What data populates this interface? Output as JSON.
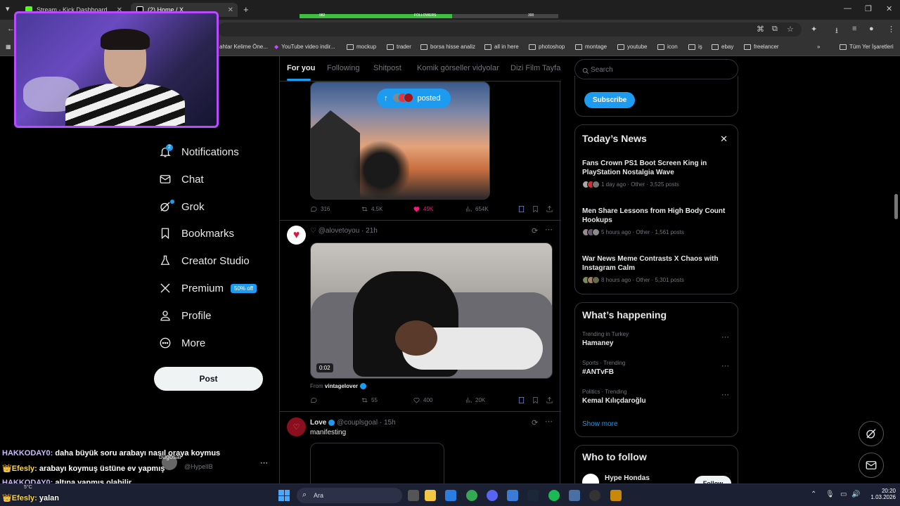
{
  "browser": {
    "tabs": [
      {
        "title": "Stream - Kick Dashboard",
        "color": "#53fc18"
      },
      {
        "title": "(2) Home / X",
        "color": "#ffffff"
      }
    ],
    "overlay_bar": {
      "left_value": "982",
      "center_label": "FOLLOWERS",
      "right_value": "300",
      "progress": 0.59
    },
    "bookmarks": [
      {
        "label": "ahtar Kelime Öne...",
        "icon": "folder-icon"
      },
      {
        "label": "YouTube video indir...",
        "icon": "bookmark-icon"
      },
      {
        "label": "mockup",
        "icon": "folder-icon"
      },
      {
        "label": "trader",
        "icon": "folder-icon"
      },
      {
        "label": "borsa hisse analiz",
        "icon": "folder-icon"
      },
      {
        "label": "all in here",
        "icon": "folder-icon"
      },
      {
        "label": "photoshop",
        "icon": "folder-icon"
      },
      {
        "label": "montage",
        "icon": "folder-icon"
      },
      {
        "label": "youtube",
        "icon": "folder-icon"
      },
      {
        "label": "icon",
        "icon": "folder-icon"
      },
      {
        "label": "iş",
        "icon": "folder-icon"
      },
      {
        "label": "ebay",
        "icon": "folder-icon"
      },
      {
        "label": "freelancer",
        "icon": "folder-icon"
      }
    ],
    "all_bookmarks": "Tüm Yer İşaretleri"
  },
  "nav": {
    "items": [
      {
        "label": "Notifications",
        "icon": "bell-icon",
        "badge": "2"
      },
      {
        "label": "Chat",
        "icon": "mail-icon"
      },
      {
        "label": "Grok",
        "icon": "grok-icon"
      },
      {
        "label": "Bookmarks",
        "icon": "bookmark-icon"
      },
      {
        "label": "Creator Studio",
        "icon": "flask-icon"
      },
      {
        "label": "Premium",
        "icon": "x-logo-icon",
        "badge": "50% off"
      },
      {
        "label": "Profile",
        "icon": "person-icon"
      },
      {
        "label": "More",
        "icon": "more-circle-icon"
      }
    ],
    "post_label": "Post"
  },
  "feed": {
    "tabs": [
      "For you",
      "Following",
      "Shitpost",
      "Komik görseller vidyolar",
      "Dizi Film Tayfa"
    ],
    "posted_pill": "posted",
    "post1": {
      "replies": "316",
      "reposts": "4.5K",
      "likes": "49K",
      "views": "654K"
    },
    "post2": {
      "handle": "♡ @alovetoyou · 21h",
      "video_time": "0:02",
      "from_prefix": "From",
      "from_user": "vintagelover",
      "replies": "",
      "reposts": "55",
      "likes": "400",
      "views": "20K"
    },
    "post3": {
      "name": "Love",
      "handle": "@couplsgoal · 15h",
      "text": "manifesting"
    }
  },
  "right": {
    "search_placeholder": "Search",
    "subscribe_label": "Subscribe",
    "news_title": "Today’s News",
    "news": [
      {
        "title": "Fans Crown PS1 Boot Screen King in PlayStation Nostalgia Wave",
        "meta": "1 day ago · Other · 3,525 posts"
      },
      {
        "title": "Men Share Lessons from High Body Count Hookups",
        "meta": "5 hours ago · Other · 1,561 posts"
      },
      {
        "title": "War News Meme Contrasts X Chaos with Instagram Calm",
        "meta": "8 hours ago · Other · 5,301 posts"
      }
    ],
    "happening_title": "What’s happening",
    "trends": [
      {
        "category": "Trending in Turkey",
        "name": "Hamaney"
      },
      {
        "category": "Sports · Trending",
        "name": "#ANTvFB"
      },
      {
        "category": "Politics · Trending",
        "name": "Kemal Kılıçdaroğlu"
      }
    ],
    "show_more": "Show more",
    "follow_title": "Who to follow",
    "follow_name": "Hype Hondas",
    "follow_label": "Follow"
  },
  "chat_overlay": [
    {
      "user": "HAKKODAY0:",
      "text": "daha büyük soru arabayı nasıl oraya koymus"
    },
    {
      "user": "Efesly:",
      "text": "arabayı koymuş üstüne ev yapmış"
    },
    {
      "user": "HAKKODAY0:",
      "text": "altına yapmıs olabilir"
    },
    {
      "user": "Efesly:",
      "text": "yalan"
    }
  ],
  "sidebar_account": {
    "name": "bugosal",
    "handle": "@HypelIB"
  },
  "taskbar": {
    "search_placeholder": "Ara",
    "time": "20:20",
    "date": "1.03.2026",
    "weather": "5°C"
  },
  "colors": {
    "accent": "#1d9bf0",
    "background": "#000000",
    "webcam_border": "#b94bff",
    "like": "#f91880"
  }
}
